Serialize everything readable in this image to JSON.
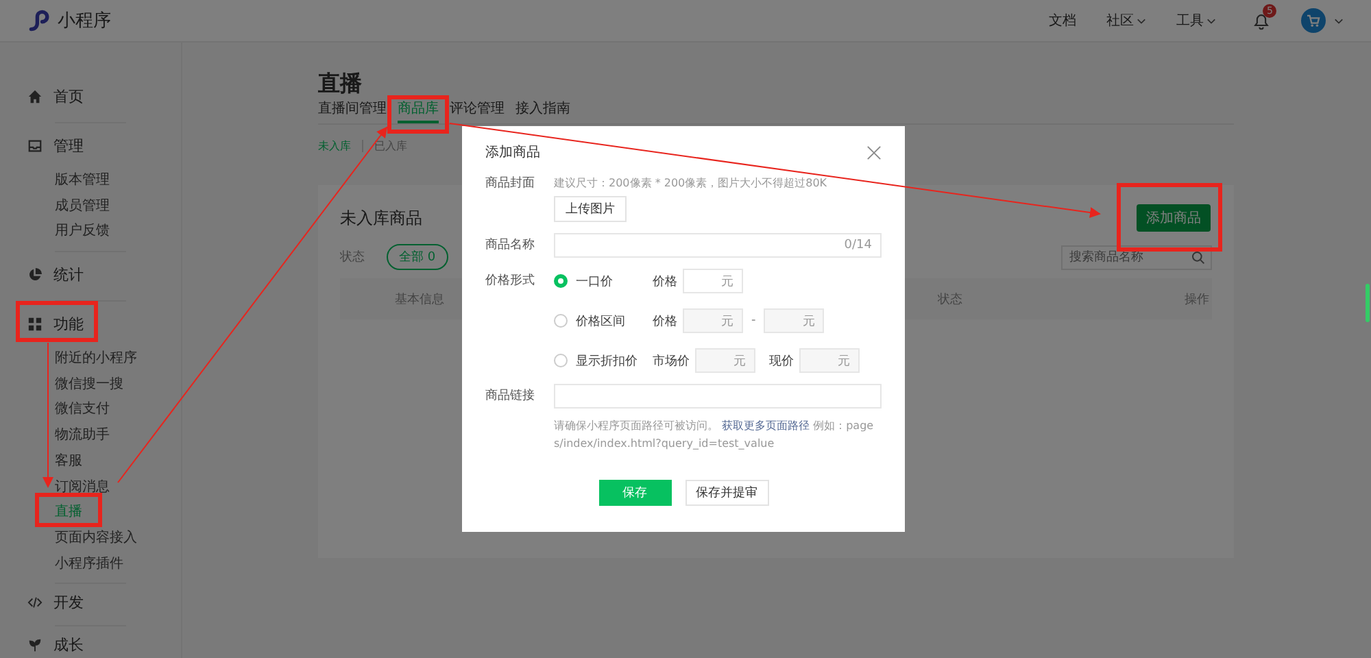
{
  "header": {
    "brand": "小程序",
    "nav": [
      {
        "label": "文档",
        "has_menu": false
      },
      {
        "label": "社区",
        "has_menu": true
      },
      {
        "label": "工具",
        "has_menu": true
      }
    ],
    "notifications": "5"
  },
  "sidebar": [
    {
      "label": "首页"
    },
    {
      "label": "管理",
      "children": [
        {
          "label": "版本管理",
          "selected": false
        },
        {
          "label": "成员管理",
          "selected": false
        },
        {
          "label": "用户反馈",
          "selected": false
        }
      ]
    },
    {
      "label": "统计"
    },
    {
      "label": "功能",
      "children": [
        {
          "label": "附近的小程序",
          "selected": false
        },
        {
          "label": "微信搜一搜",
          "selected": false
        },
        {
          "label": "微信支付",
          "selected": false
        },
        {
          "label": "物流助手",
          "selected": false
        },
        {
          "label": "客服",
          "selected": false
        },
        {
          "label": "订阅消息",
          "selected": false
        },
        {
          "label": "直播",
          "selected": true
        },
        {
          "label": "页面内容接入",
          "selected": false
        },
        {
          "label": "小程序插件",
          "selected": false
        }
      ]
    },
    {
      "label": "开发"
    },
    {
      "label": "成长"
    }
  ],
  "page": {
    "title": "直播",
    "tabs": [
      {
        "label": "直播间管理",
        "selected": false
      },
      {
        "label": "商品库",
        "selected": true
      },
      {
        "label": "评论管理",
        "selected": false
      },
      {
        "label": "接入指南",
        "selected": false
      }
    ],
    "subtabs": [
      {
        "label": "未入库",
        "selected": true
      },
      {
        "label": "已入库",
        "selected": false
      }
    ],
    "card": {
      "title": "未入库商品",
      "add_button": "添加商品",
      "filter_label": "状态",
      "filters": [
        {
          "label": "全部 0",
          "selected": true
        }
      ],
      "search": {
        "placeholder": "搜索商品名称"
      },
      "columns": [
        "基本信息",
        "状态",
        "操作"
      ]
    }
  },
  "modal": {
    "title": "添加商品",
    "cover": {
      "label": "商品封面",
      "hint": "建议尺寸：200像素 * 200像素，图片大小不得超过80K",
      "button": "上传图片"
    },
    "name": {
      "label": "商品名称",
      "counter": "0/14"
    },
    "price": {
      "label": "价格形式",
      "options": [
        {
          "label": "一口价",
          "selected": true,
          "fields": [
            {
              "label": "价格",
              "inputs": [
                "元"
              ]
            }
          ]
        },
        {
          "label": "价格区间",
          "selected": false,
          "fields": [
            {
              "label": "价格",
              "inputs": [
                "元",
                "元"
              ],
              "separator": "-"
            }
          ]
        },
        {
          "label": "显示折扣价",
          "selected": false,
          "fields": [
            {
              "label": "市场价",
              "inputs": [
                "元"
              ]
            },
            {
              "label": "现价",
              "inputs": [
                "元"
              ]
            }
          ]
        }
      ]
    },
    "link": {
      "label": "商品链接",
      "help": "请确保小程序页面路径可被访问。",
      "help_link": "获取更多页面路径",
      "help_example": "例如：pages/index/index.html?query_id=test_value"
    },
    "buttons": [
      {
        "label": "保存",
        "primary": true
      },
      {
        "label": "保存并提审",
        "primary": false
      }
    ]
  }
}
